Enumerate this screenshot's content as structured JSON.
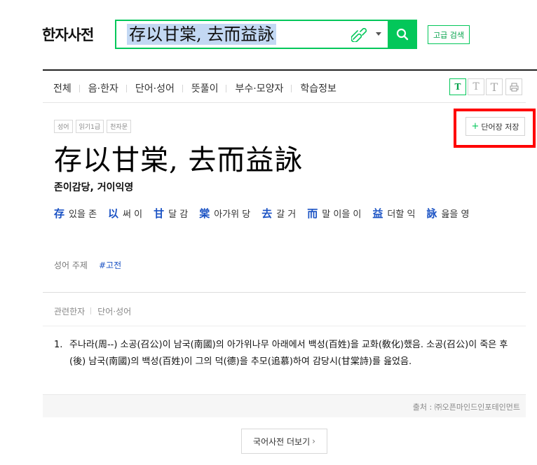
{
  "header": {
    "logo": "한자사전",
    "search": {
      "value": "存以甘棠, 去而益詠"
    },
    "advanced_search_label": "고급 검색"
  },
  "tabs": [
    {
      "label": "전체"
    },
    {
      "label": "음·한자"
    },
    {
      "label": "단어·성어"
    },
    {
      "label": "뜻풀이"
    },
    {
      "label": "부수·모양자"
    },
    {
      "label": "학습정보"
    }
  ],
  "font_buttons": [
    "T",
    "T",
    "T"
  ],
  "entry": {
    "badges": [
      "성어",
      "읽기1급",
      "천자문"
    ],
    "save_label": "단어장 저장",
    "headword": "存以甘棠, 去而益詠",
    "reading": "존이감당, 거이익영",
    "chars": [
      {
        "hanja": "存",
        "meaning": "있을 존"
      },
      {
        "hanja": "以",
        "meaning": "써 이"
      },
      {
        "hanja": "甘",
        "meaning": "달 감"
      },
      {
        "hanja": "棠",
        "meaning": "아가위 당"
      },
      {
        "hanja": "去",
        "meaning": "갈 거"
      },
      {
        "hanja": "而",
        "meaning": "말 이을 이"
      },
      {
        "hanja": "益",
        "meaning": "더할 익"
      },
      {
        "hanja": "詠",
        "meaning": "읊을 영"
      }
    ],
    "topic_label": "성어 주제",
    "topic_tag": "#고전"
  },
  "related_tabs": [
    "관련한자",
    "단어·성어"
  ],
  "definition": {
    "number": "1.",
    "text": "주나라(周--) 소공(召公)이 남국(南國)의 아가위나무 아래에서 백성(百姓)을 교화(敎化)했음. 소공(召公)이 죽은 후(後) 남국(南國)의 백성(百姓)이 그의 덕(德)을 추모(追慕)하여 감당시(甘棠詩)를 읊었음."
  },
  "source": "출처 : ㈜오픈마인드인포테인먼트",
  "more_label": "국어사전 더보기",
  "colors": {
    "accent": "#03c75a",
    "link": "#1a52c4",
    "highlight": "#ff0000"
  }
}
